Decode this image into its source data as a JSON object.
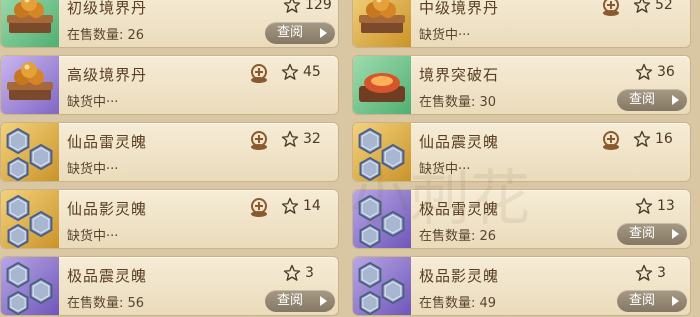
{
  "button_label": "查阅",
  "watermark": "小刺花",
  "items": [
    {
      "name": "初级境界丹",
      "sub": "在售数量: 26",
      "count": "129",
      "has_add": false,
      "has_button": true,
      "thumb": "green",
      "icon": "pill-icon"
    },
    {
      "name": "中级境界丹",
      "sub": "缺货中···",
      "count": "52",
      "has_add": true,
      "has_button": false,
      "thumb": "gold",
      "icon": "pill-icon"
    },
    {
      "name": "高级境界丹",
      "sub": "缺货中···",
      "count": "45",
      "has_add": true,
      "has_button": false,
      "thumb": "purple",
      "icon": "pill-icon"
    },
    {
      "name": "境界突破石",
      "sub": "在售数量: 30",
      "count": "36",
      "has_add": false,
      "has_button": true,
      "thumb": "green",
      "icon": "stone-icon"
    },
    {
      "name": "仙品雷灵魄",
      "sub": "缺货中···",
      "count": "32",
      "has_add": true,
      "has_button": false,
      "thumb": "gold",
      "icon": "hexagon-crystal-icon"
    },
    {
      "name": "仙品震灵魄",
      "sub": "缺货中···",
      "count": "16",
      "has_add": true,
      "has_button": false,
      "thumb": "gold",
      "icon": "hexagon-crystal-icon"
    },
    {
      "name": "仙品影灵魄",
      "sub": "缺货中···",
      "count": "14",
      "has_add": true,
      "has_button": false,
      "thumb": "gold",
      "icon": "hexagon-crystal-icon"
    },
    {
      "name": "极品雷灵魄",
      "sub": "在售数量: 26",
      "count": "13",
      "has_add": false,
      "has_button": true,
      "thumb": "purple2",
      "icon": "hexagon-crystal-icon"
    },
    {
      "name": "极品震灵魄",
      "sub": "在售数量: 56",
      "count": "3",
      "has_add": false,
      "has_button": true,
      "thumb": "purple2",
      "icon": "hexagon-crystal-icon"
    },
    {
      "name": "极品影灵魄",
      "sub": "在售数量: 49",
      "count": "3",
      "has_add": false,
      "has_button": true,
      "thumb": "purple2",
      "icon": "hexagon-crystal-icon"
    }
  ]
}
